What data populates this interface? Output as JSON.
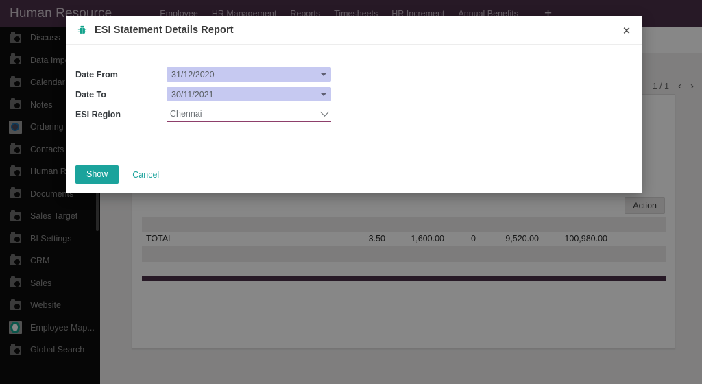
{
  "navbar": {
    "brand": "Human Resource",
    "menu": [
      {
        "label": "Employee"
      },
      {
        "label": "HR Management"
      },
      {
        "label": "Reports"
      },
      {
        "label": "Timesheets"
      },
      {
        "label": "HR Increment"
      },
      {
        "label": "Annual Benefits"
      }
    ],
    "add_label": "+"
  },
  "sidebar": {
    "items": [
      {
        "label": "Discuss",
        "icon": "app-icon"
      },
      {
        "label": "Data Import",
        "icon": "app-icon"
      },
      {
        "label": "Calendar",
        "icon": "app-icon"
      },
      {
        "label": "Notes",
        "icon": "app-icon"
      },
      {
        "label": "Ordering Po...",
        "icon": "ordering-points-icon"
      },
      {
        "label": "Contacts",
        "icon": "app-icon"
      },
      {
        "label": "Human Resour...",
        "icon": "app-icon"
      },
      {
        "label": "Documents",
        "icon": "app-icon"
      },
      {
        "label": "Sales Target",
        "icon": "app-icon"
      },
      {
        "label": "BI Settings",
        "icon": "app-icon"
      },
      {
        "label": "CRM",
        "icon": "app-icon"
      },
      {
        "label": "Sales",
        "icon": "app-icon"
      },
      {
        "label": "Website",
        "icon": "app-icon"
      },
      {
        "label": "Employee Map...",
        "icon": "map-pin-icon"
      },
      {
        "label": "Global Search",
        "icon": "app-icon"
      }
    ]
  },
  "content": {
    "pager": {
      "count": "1 / 1",
      "prev": "‹",
      "next": "›"
    },
    "action_button": "Action",
    "report": {
      "total_row": {
        "name": "",
        "id": "",
        "period": "",
        "label": "TOTAL",
        "days": "3.50",
        "gross": "1,600.00",
        "zero": "0",
        "employer": "9,520.00",
        "total": "100,980.00",
        "branch": ""
      }
    }
  },
  "modal": {
    "title": "ESI Statement Details Report",
    "title_icon": "bug-icon",
    "close_icon": "✕",
    "fields": {
      "date_from": {
        "label": "Date From",
        "value": "31/12/2020",
        "placeholder": "dd/mm/yyyy",
        "caret_icon": "caret-down-icon"
      },
      "date_to": {
        "label": "Date To",
        "value": "30/11/2021",
        "placeholder": "dd/mm/yyyy",
        "caret_icon": "caret-down-icon"
      },
      "esi_region": {
        "label": "ESI Region",
        "value": "Chennai",
        "options": [
          "Chennai"
        ],
        "chevron_icon": "chevron-down-icon"
      }
    },
    "footer": {
      "show_label": "Show",
      "cancel_label": "Cancel"
    }
  },
  "colors": {
    "navbar": "#4b3049",
    "accent_teal": "#1ba39c",
    "field_fill": "#c6c9f1",
    "select_underline": "#8e3f6b",
    "sidebar_bg": "#0d0d0d"
  }
}
